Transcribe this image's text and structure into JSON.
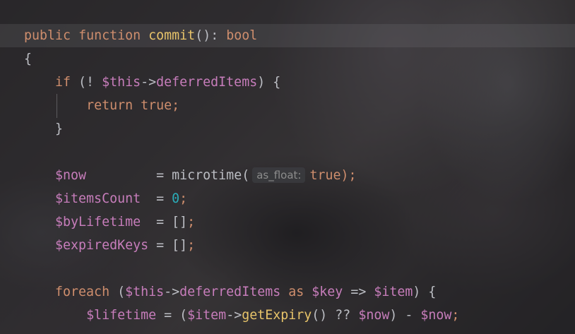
{
  "editor": {
    "lines": [
      {
        "tokens": [
          {
            "t": "public",
            "c": "kw"
          },
          {
            "t": " ",
            "c": "plain"
          },
          {
            "t": "function",
            "c": "kw"
          },
          {
            "t": " ",
            "c": "plain"
          },
          {
            "t": "commit",
            "c": "fnc"
          },
          {
            "t": "(): ",
            "c": "plain"
          },
          {
            "t": "bool",
            "c": "kw"
          }
        ]
      },
      {
        "tokens": [
          {
            "t": "{",
            "c": "plain"
          }
        ]
      },
      {
        "tokens": [
          {
            "t": "    ",
            "c": "plain"
          },
          {
            "t": "if",
            "c": "kw"
          },
          {
            "t": " (! ",
            "c": "plain"
          },
          {
            "t": "$this",
            "c": "var"
          },
          {
            "t": "->",
            "c": "plain"
          },
          {
            "t": "deferredItems",
            "c": "prop"
          },
          {
            "t": ") {",
            "c": "plain"
          }
        ]
      },
      {
        "tokens": [
          {
            "t": "        ",
            "c": "plain"
          },
          {
            "t": "return",
            "c": "kw"
          },
          {
            "t": " ",
            "c": "plain"
          },
          {
            "t": "true",
            "c": "kw"
          },
          {
            "t": ";",
            "c": "semi"
          }
        ]
      },
      {
        "tokens": [
          {
            "t": "    }",
            "c": "plain"
          }
        ]
      },
      {
        "tokens": []
      },
      {
        "tokens": [
          {
            "t": "    ",
            "c": "plain"
          },
          {
            "t": "$now",
            "c": "var"
          },
          {
            "t": "         = ",
            "c": "plain"
          },
          {
            "t": "microtime",
            "c": "plain"
          },
          {
            "t": "(",
            "c": "plain"
          },
          {
            "t": "as_float:",
            "c": "hint"
          },
          {
            "t": "true",
            "c": "kw"
          },
          {
            "t": ");",
            "c": "semi"
          }
        ]
      },
      {
        "tokens": [
          {
            "t": "    ",
            "c": "plain"
          },
          {
            "t": "$itemsCount",
            "c": "var"
          },
          {
            "t": "  = ",
            "c": "plain"
          },
          {
            "t": "0",
            "c": "num"
          },
          {
            "t": ";",
            "c": "semi"
          }
        ]
      },
      {
        "tokens": [
          {
            "t": "    ",
            "c": "plain"
          },
          {
            "t": "$byLifetime",
            "c": "var"
          },
          {
            "t": "  = ",
            "c": "plain"
          },
          {
            "t": "[]",
            "c": "plain"
          },
          {
            "t": ";",
            "c": "semi"
          }
        ]
      },
      {
        "tokens": [
          {
            "t": "    ",
            "c": "plain"
          },
          {
            "t": "$expiredKeys",
            "c": "var"
          },
          {
            "t": " = ",
            "c": "plain"
          },
          {
            "t": "[]",
            "c": "plain"
          },
          {
            "t": ";",
            "c": "semi"
          }
        ]
      },
      {
        "tokens": []
      },
      {
        "tokens": [
          {
            "t": "    ",
            "c": "plain"
          },
          {
            "t": "foreach",
            "c": "kw"
          },
          {
            "t": " (",
            "c": "plain"
          },
          {
            "t": "$this",
            "c": "var"
          },
          {
            "t": "->",
            "c": "plain"
          },
          {
            "t": "deferredItems",
            "c": "prop"
          },
          {
            "t": " ",
            "c": "plain"
          },
          {
            "t": "as",
            "c": "kw"
          },
          {
            "t": " ",
            "c": "plain"
          },
          {
            "t": "$key",
            "c": "var"
          },
          {
            "t": " => ",
            "c": "plain"
          },
          {
            "t": "$item",
            "c": "var"
          },
          {
            "t": ") {",
            "c": "plain"
          }
        ]
      },
      {
        "tokens": [
          {
            "t": "        ",
            "c": "plain"
          },
          {
            "t": "$lifetime",
            "c": "var"
          },
          {
            "t": " = (",
            "c": "plain"
          },
          {
            "t": "$item",
            "c": "var"
          },
          {
            "t": "->",
            "c": "plain"
          },
          {
            "t": "getExpiry",
            "c": "fnc"
          },
          {
            "t": "() ?? ",
            "c": "plain"
          },
          {
            "t": "$now",
            "c": "var"
          },
          {
            "t": ") - ",
            "c": "plain"
          },
          {
            "t": "$now",
            "c": "var"
          },
          {
            "t": ";",
            "c": "semi"
          }
        ]
      }
    ]
  }
}
